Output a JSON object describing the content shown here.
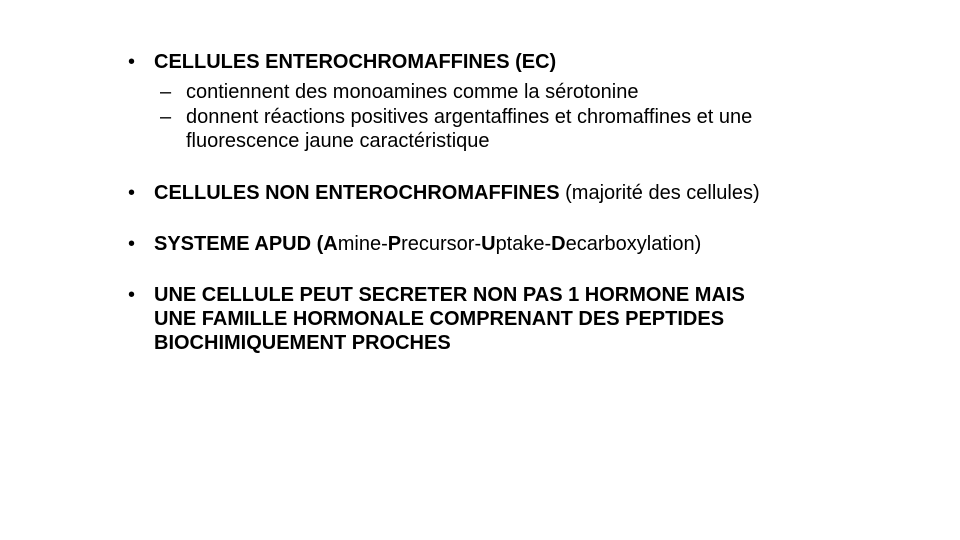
{
  "bullet_char": "•",
  "dash_char": "–",
  "items": [
    {
      "title": "CELLULES ENTEROCHROMAFFINES (EC)",
      "subs": [
        "contiennent des monoamines comme la sérotonine",
        "donnent réactions positives argentaffines et chromaffines et une fluorescence jaune caractéristique"
      ]
    },
    {
      "title": "CELLULES NON ENTEROCHROMAFFINES",
      "rest": " (majorité des cellules)"
    },
    {
      "parts": [
        {
          "text": "SYSTEME APUD (",
          "bold": true
        },
        {
          "text": "A",
          "bold": true
        },
        {
          "text": "mine-",
          "bold": false
        },
        {
          "text": "P",
          "bold": true
        },
        {
          "text": "recursor-",
          "bold": false
        },
        {
          "text": "U",
          "bold": true
        },
        {
          "text": "ptake-",
          "bold": false
        },
        {
          "text": "D",
          "bold": true
        },
        {
          "text": "ecarboxylation)",
          "bold": false
        }
      ]
    },
    {
      "title": "UNE CELLULE PEUT SECRETER NON PAS 1 HORMONE MAIS UNE FAMILLE HORMONALE COMPRENANT DES PEPTIDES BIOCHIMIQUEMENT PROCHES"
    }
  ]
}
